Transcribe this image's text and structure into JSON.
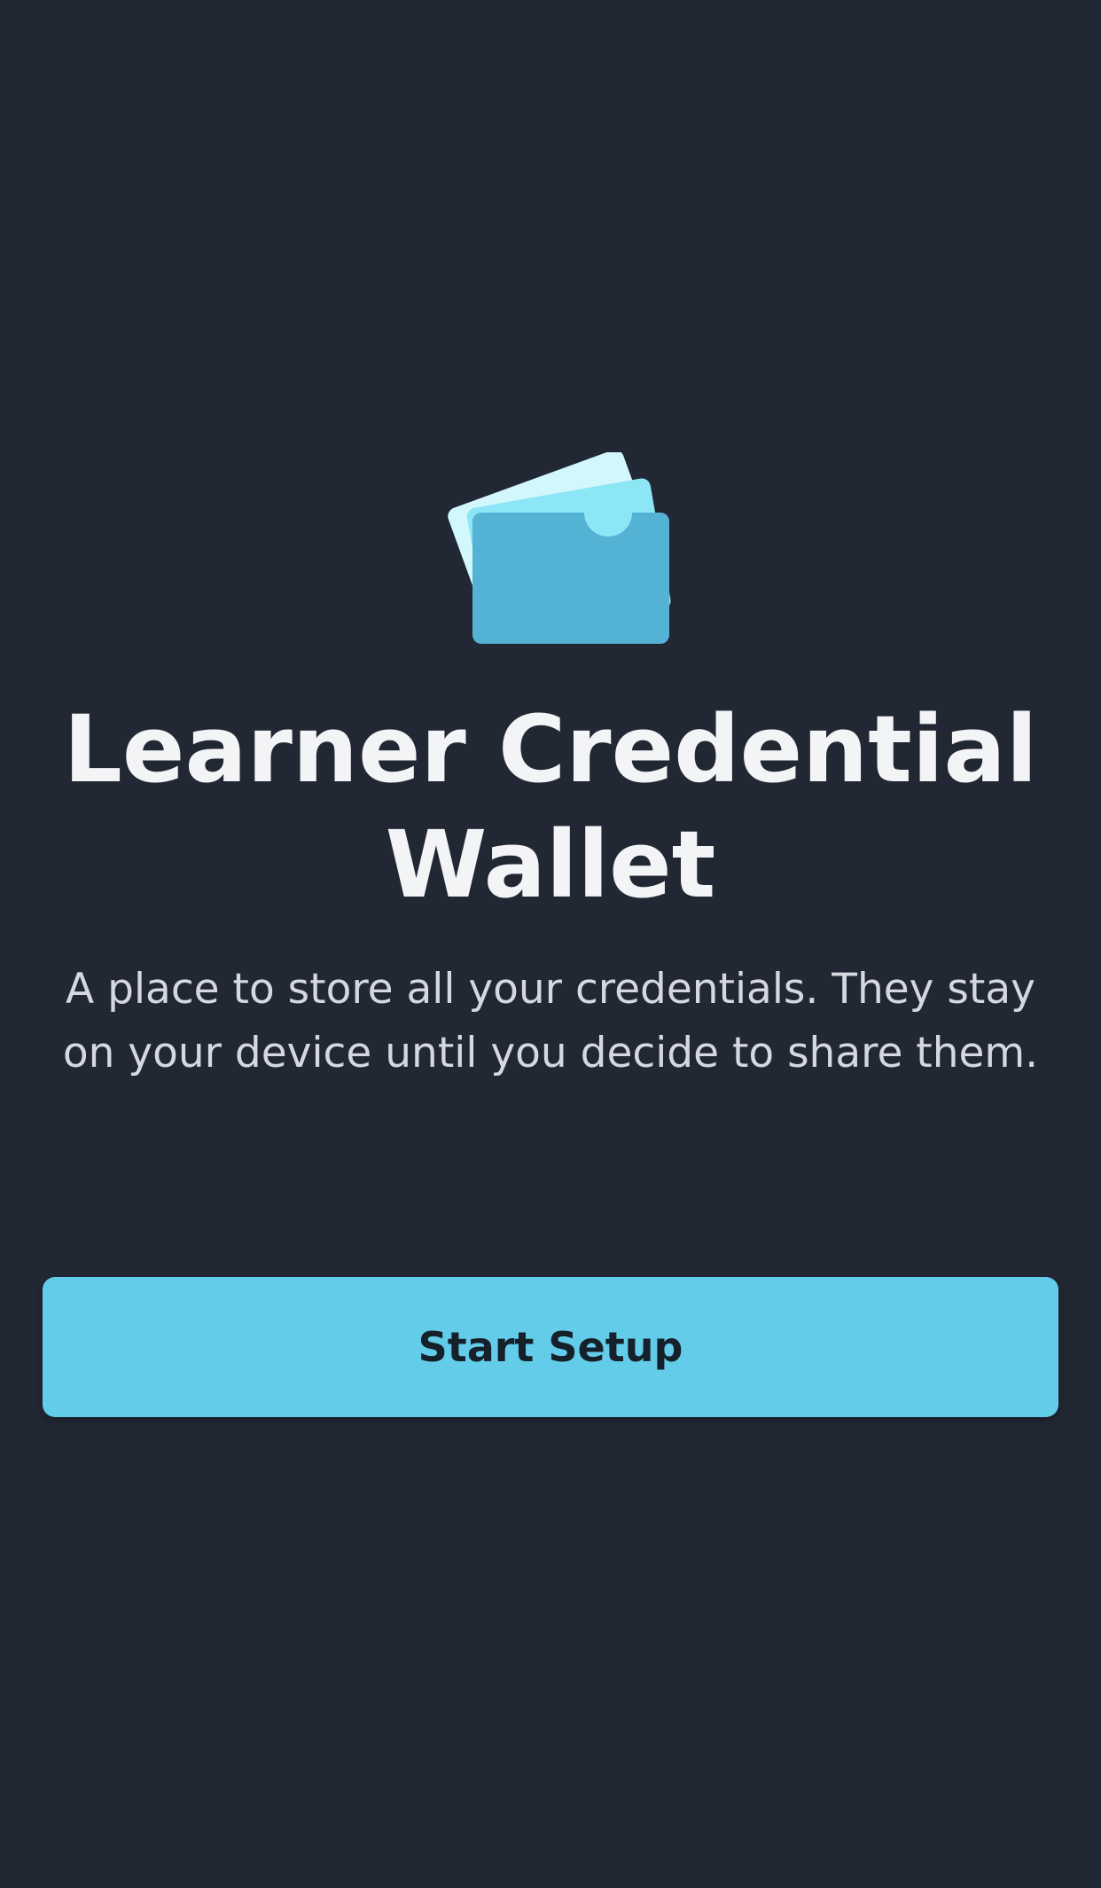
{
  "app": {
    "title": "Learner Credential Wallet",
    "title_line1": "Learner Credential",
    "title_line2": "Wallet",
    "description": "A place to store all your credentials. They stay on your device until you decide to share them."
  },
  "actions": {
    "start_setup_label": "Start Setup"
  },
  "icons": {
    "hero": "wallet-cards-icon"
  },
  "colors": {
    "background": "#222734",
    "accent": "#63cde9",
    "title_text": "#f3f4f6",
    "body_text": "#d5d8df",
    "button_text": "#16202b"
  }
}
